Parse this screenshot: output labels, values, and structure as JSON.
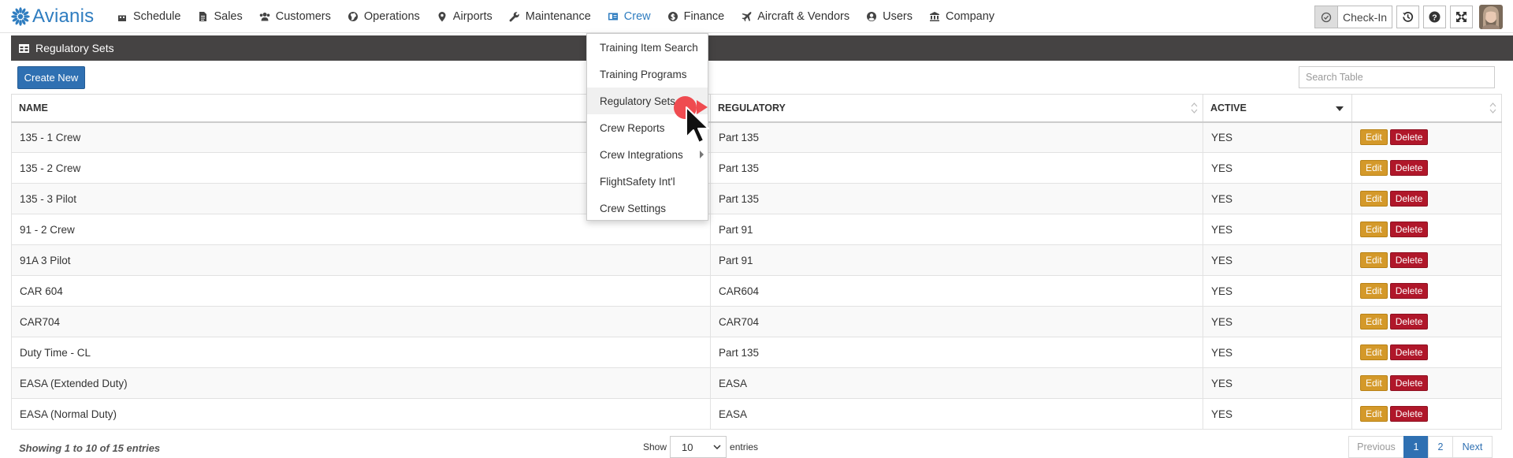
{
  "brand": {
    "name": "Avianis"
  },
  "nav": [
    {
      "label": "Schedule",
      "icon": "calendar-icon",
      "active": false
    },
    {
      "label": "Sales",
      "icon": "document-icon",
      "active": false
    },
    {
      "label": "Customers",
      "icon": "users-icon",
      "active": false
    },
    {
      "label": "Operations",
      "icon": "globe-icon",
      "active": false
    },
    {
      "label": "Airports",
      "icon": "map-marker-icon",
      "active": false
    },
    {
      "label": "Maintenance",
      "icon": "wrench-icon",
      "active": false
    },
    {
      "label": "Crew",
      "icon": "id-card-icon",
      "active": true
    },
    {
      "label": "Finance",
      "icon": "dollar-circle-icon",
      "active": false
    },
    {
      "label": "Aircraft & Vendors",
      "icon": "plane-icon",
      "active": false
    },
    {
      "label": "Users",
      "icon": "user-circle-icon",
      "active": false
    },
    {
      "label": "Company",
      "icon": "bank-icon",
      "active": false
    }
  ],
  "toolbar": {
    "checkin_label": "Check-In"
  },
  "panel": {
    "title": "Regulatory Sets"
  },
  "actions": {
    "create_label": "Create New",
    "edit_label": "Edit",
    "delete_label": "Delete"
  },
  "search": {
    "placeholder": "Search Table"
  },
  "table": {
    "columns": [
      "NAME",
      "REGULATORY",
      "ACTIVE",
      ""
    ],
    "rows": [
      {
        "name": "135 - 1 Crew",
        "regulatory": "Part 135",
        "active": "YES"
      },
      {
        "name": "135 - 2 Crew",
        "regulatory": "Part 135",
        "active": "YES"
      },
      {
        "name": "135 - 3 Pilot",
        "regulatory": "Part 135",
        "active": "YES"
      },
      {
        "name": "91 - 2 Crew",
        "regulatory": "Part 91",
        "active": "YES"
      },
      {
        "name": "91A 3 Pilot",
        "regulatory": "Part 91",
        "active": "YES"
      },
      {
        "name": "CAR 604",
        "regulatory": "CAR604",
        "active": "YES"
      },
      {
        "name": "CAR704",
        "regulatory": "CAR704",
        "active": "YES"
      },
      {
        "name": "Duty Time - CL",
        "regulatory": "Part 135",
        "active": "YES"
      },
      {
        "name": "EASA (Extended Duty)",
        "regulatory": "EASA",
        "active": "YES"
      },
      {
        "name": "EASA (Normal Duty)",
        "regulatory": "EASA",
        "active": "YES"
      }
    ]
  },
  "footer": {
    "info": "Showing 1 to 10 of 15 entries",
    "show_label": "Show",
    "entries_value": "10",
    "entries_label": "entries",
    "pagination": {
      "previous": "Previous",
      "pages": [
        "1",
        "2"
      ],
      "current": "1",
      "next": "Next"
    }
  },
  "crew_menu": {
    "items": [
      {
        "label": "Training Item Search",
        "hover": false,
        "submenu": false
      },
      {
        "label": "Training Programs",
        "hover": false,
        "submenu": false
      },
      {
        "label": "Regulatory Sets",
        "hover": true,
        "submenu": false
      },
      {
        "label": "Crew Reports",
        "hover": false,
        "submenu": false
      },
      {
        "label": "Crew Integrations",
        "hover": false,
        "submenu": true
      },
      {
        "label": "FlightSafety Int'l",
        "hover": false,
        "submenu": false
      },
      {
        "label": "Crew Settings",
        "hover": false,
        "submenu": false
      }
    ]
  },
  "colors": {
    "brand": "#2f7dc0",
    "primary": "#2f70b2",
    "edit": "#d4992a",
    "delete": "#b0172a",
    "header_bar": "#454343",
    "click_marker": "#ef4b50"
  }
}
